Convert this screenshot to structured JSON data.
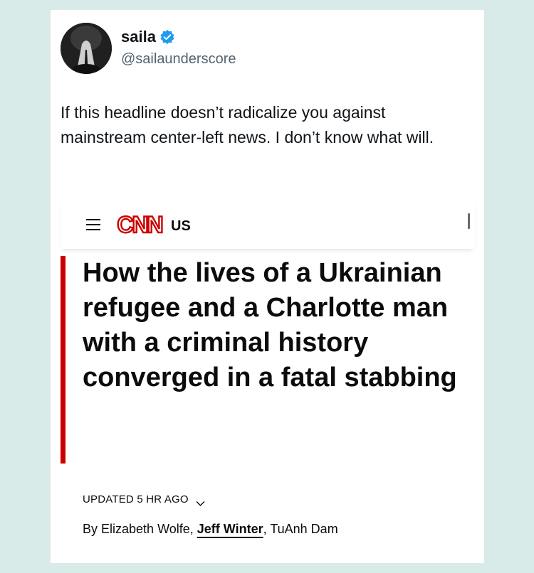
{
  "tweet": {
    "user_name": "saila",
    "handle": "@sailaunderscore",
    "text": "If this headline doesn’t radicalize you against mainstream center-left news. I don’t know what will."
  },
  "cnn": {
    "logo_text": "CNN",
    "edition": "US",
    "headline": "How the lives of a Ukrainian refugee and a Charlotte man with a criminal history converged in a fatal stabbing",
    "updated": "UPDATED 5 HR AGO",
    "byline": {
      "prefix": "By ",
      "authors": [
        "Elizabeth Wolfe",
        "Jeff Winter",
        "TuAnh Dam"
      ],
      "separator": ", "
    }
  },
  "colors": {
    "background": "#d9ebe8",
    "cnn_red": "#cc0000",
    "verified_blue": "#1d9bf0"
  },
  "icons": [
    "verified-badge-icon",
    "menu-icon",
    "chevron-down-icon"
  ]
}
